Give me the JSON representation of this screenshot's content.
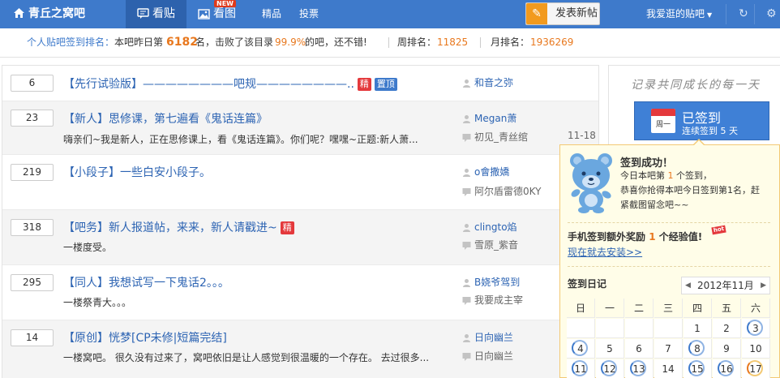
{
  "topbar": {
    "brand": "青丘之窝吧",
    "tabs": [
      {
        "label": "看贴"
      },
      {
        "label": "看图"
      }
    ],
    "new_badge": "NEW",
    "links": [
      "精品",
      "投票"
    ],
    "post_button": "发表新帖",
    "fav_menu": "我爱逛的贴吧"
  },
  "rank": {
    "label": "个人贴吧签到排名：",
    "text1": "本吧昨日第",
    "rank_number": "6182",
    "text2": "名，击败了该目录",
    "percent": "99.9%",
    "text3": "的吧，还不错!",
    "week_label": "周排名：",
    "week_value": "11825",
    "month_label": "月排名：",
    "month_value": "1936269"
  },
  "threads": [
    {
      "replies": "6",
      "title": "【先行试验版】————————吧规————————..",
      "tags": [
        "精",
        "置顶"
      ],
      "abstract": "",
      "author": "和音之弥",
      "last_reply": "",
      "date": ""
    },
    {
      "replies": "23",
      "title": "【新人】思修课，第七遍看《鬼话连篇》",
      "tags": [],
      "abstract": "嗨亲们~我是新人，正在思修课上，看《鬼话连篇》。你们呢？嘿嘿~正题:新人萧...",
      "author": "Megan萧",
      "last_reply": "初见_青丝绾",
      "date": "11-18"
    },
    {
      "replies": "219",
      "title": "【小段子】一些白安小段子。",
      "tags": [],
      "abstract": "",
      "author": "o會撒嬌",
      "last_reply": "阿尔盾雷德0KY",
      "date": ""
    },
    {
      "replies": "318",
      "title": "【吧务】新人报道帖，来来，新人请戳进~",
      "tags": [
        "精"
      ],
      "abstract": "一楼度受。",
      "author": "clingto焰",
      "last_reply": "雪原_紫音",
      "date": ""
    },
    {
      "replies": "295",
      "title": "【同人】我想试写一下鬼话2。。。",
      "tags": [],
      "abstract": "一楼祭青大。。。",
      "author": "B娆爷驾到",
      "last_reply": "我要成主宰",
      "date": ""
    },
    {
      "replies": "14",
      "title": "【原创】恍梦[CP未修|短篇完结]",
      "tags": [],
      "abstract": "一楼窝吧。 很久没有过来了，窝吧依旧是让人感觉到很温暖的一个存在。 去过很多...",
      "author": "日向幽兰",
      "last_reply": "日向幽兰",
      "date": ""
    }
  ],
  "sidebar": {
    "slogan": "记录共同成长的每一天",
    "signed_label": "已签到",
    "streak": "连续签到 5 天",
    "calendar_icon_text": "周一",
    "popup": {
      "title": "签到成功！",
      "line1_pre": "今日本吧第",
      "line1_num": "1",
      "line1_post": "个签到，",
      "line2": "恭喜你抢得本吧今日签到第1名，赶",
      "line3": "紧截图留念吧~~",
      "mobile_pre": "手机签到额外奖励",
      "mobile_num": "1",
      "mobile_post": "个经验值!",
      "hot": "hot",
      "install": "现在就去安装>>",
      "calendar_title": "签到日记",
      "month": "2012年11月",
      "weekdays": [
        "日",
        "一",
        "二",
        "三",
        "四",
        "五",
        "六"
      ],
      "days": [
        [
          "",
          "",
          "",
          "",
          "1",
          "2",
          "3"
        ],
        [
          "4",
          "5",
          "6",
          "7",
          "8",
          "9",
          "10"
        ],
        [
          "11",
          "12",
          "13",
          "14",
          "15",
          "16",
          "17"
        ]
      ],
      "signed_days": [
        "3",
        "4",
        "8",
        "11",
        "12",
        "13",
        "15",
        "16",
        "17"
      ],
      "today": "17"
    }
  },
  "colors": {
    "brand_blue": "#3e7acb",
    "orange": "#e8781e",
    "red": "#e4393c"
  }
}
